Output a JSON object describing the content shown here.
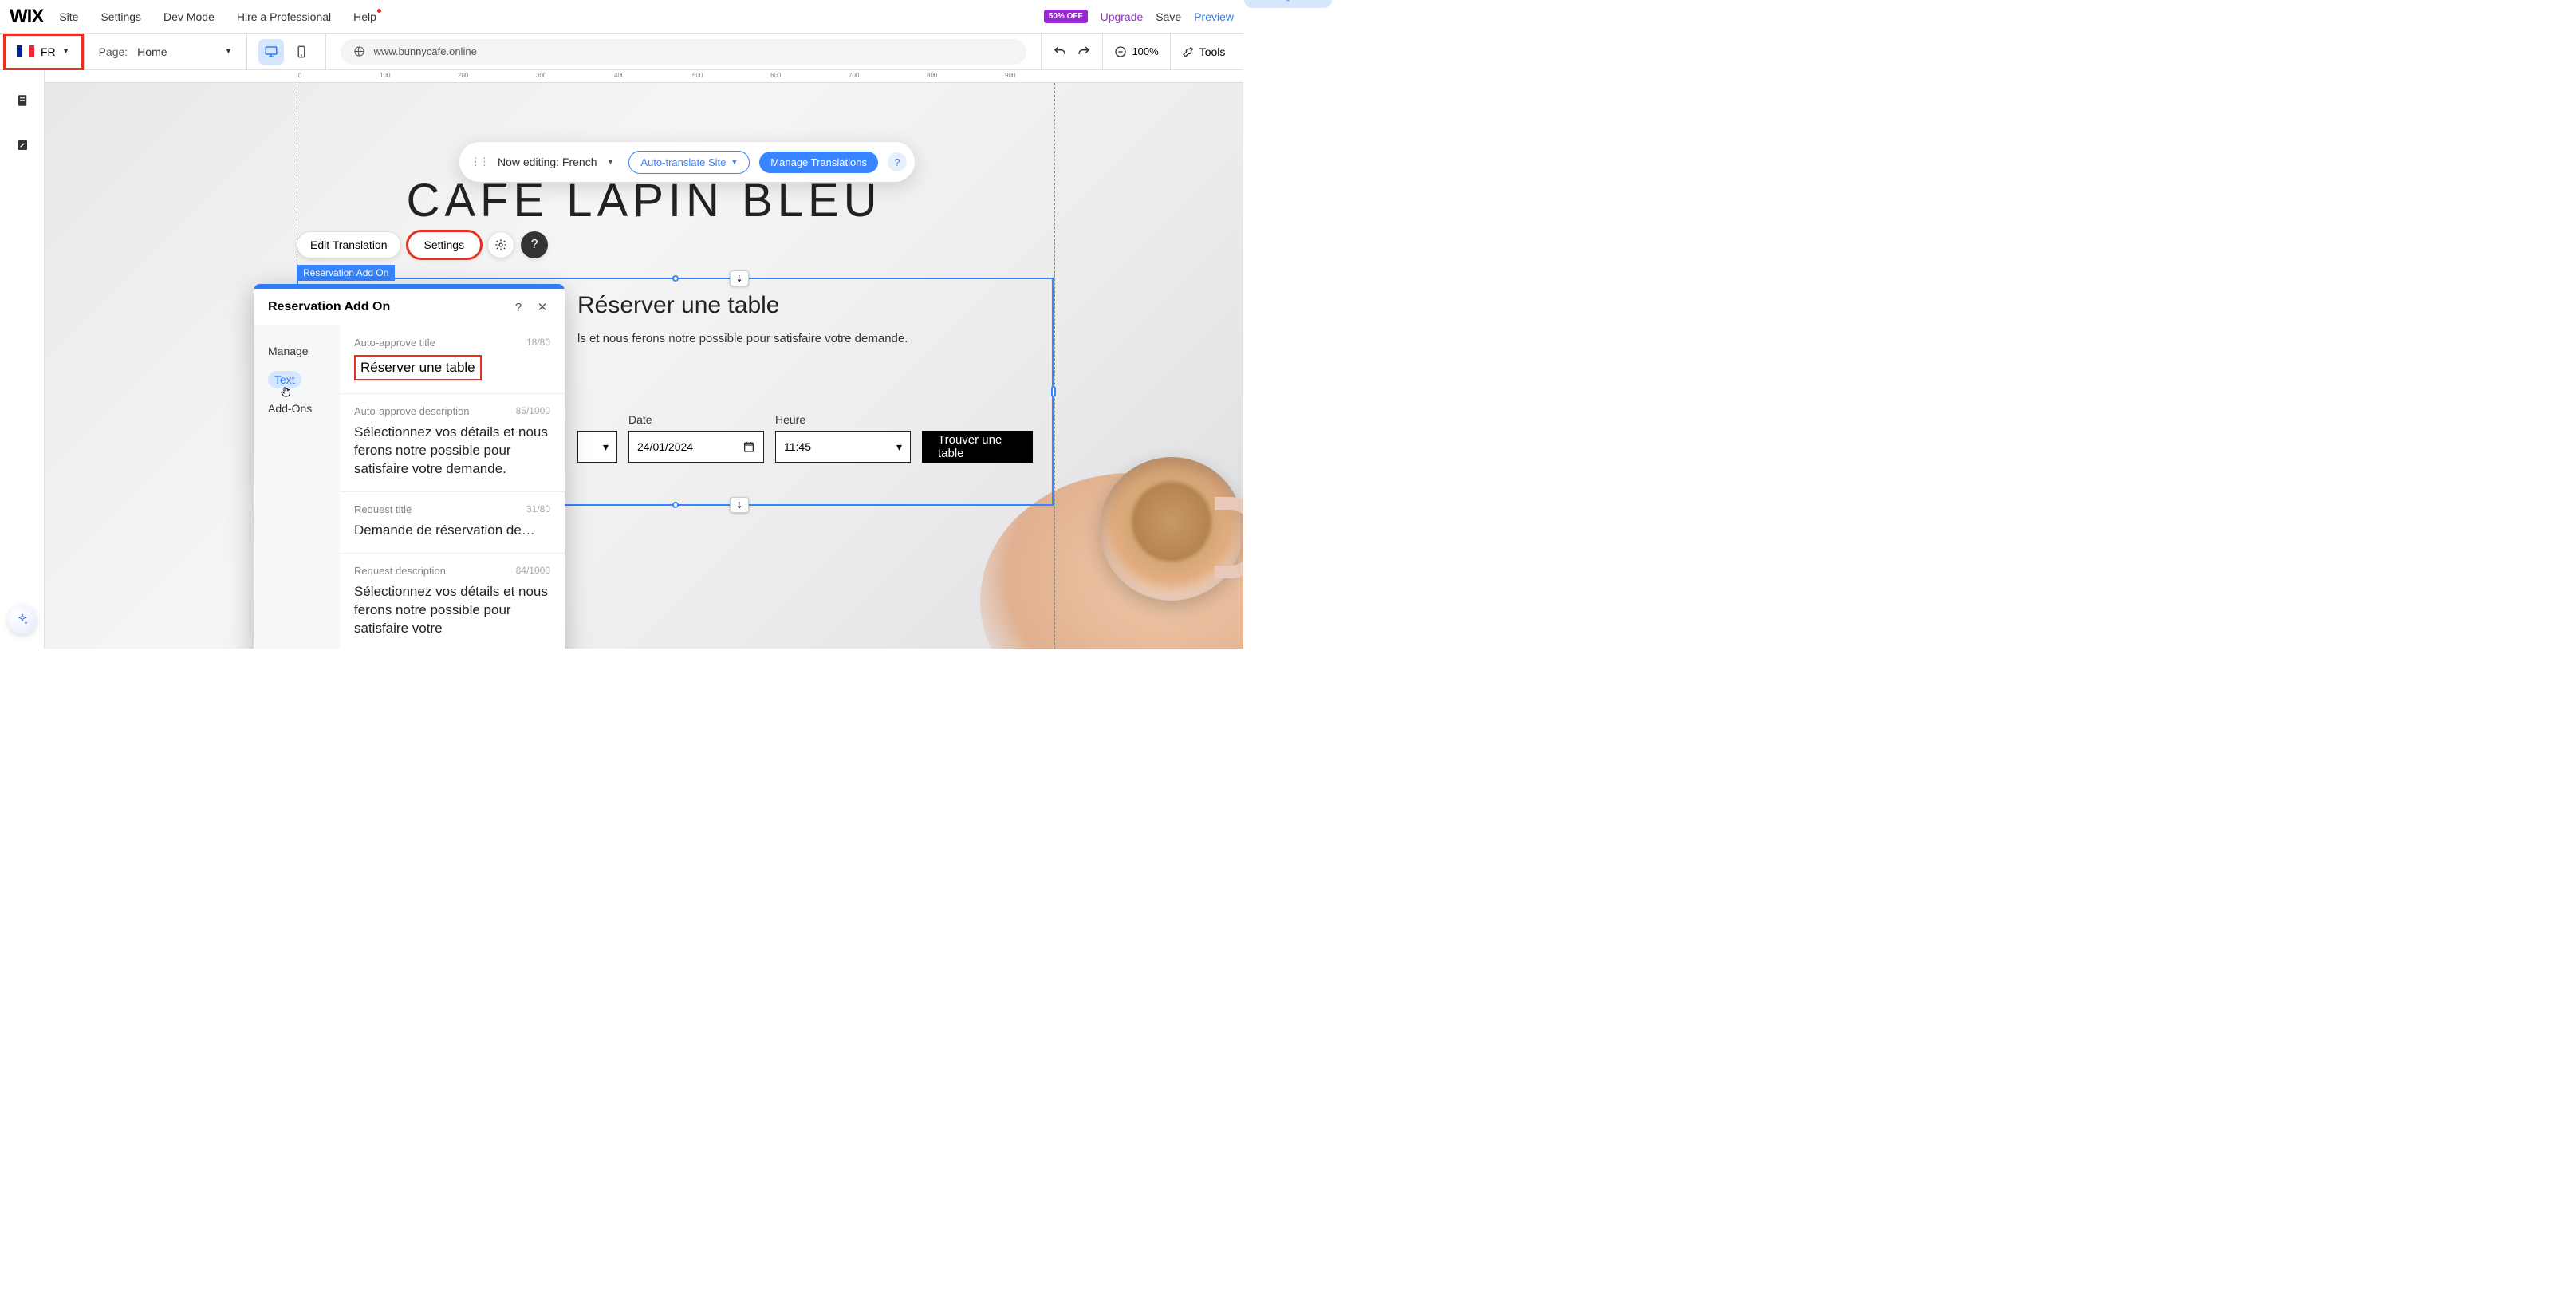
{
  "topbar": {
    "logo": "WIX",
    "menu": [
      "Site",
      "Settings",
      "Dev Mode",
      "Hire a Professional",
      "Help"
    ],
    "badge": "50% OFF",
    "upgrade": "Upgrade",
    "save": "Save",
    "preview": "Preview"
  },
  "secondbar": {
    "lang_code": "FR",
    "page_label": "Page:",
    "page_name": "Home",
    "url": "www.bunnycafe.online",
    "zoom": "100%",
    "tools": "Tools"
  },
  "editbar": {
    "now_editing": "Now editing: French",
    "auto_translate": "Auto-translate Site",
    "manage": "Manage Translations"
  },
  "site": {
    "title": "CAFÉ LAPIN BLEU"
  },
  "float_toolbar": {
    "edit": "Edit Translation",
    "settings": "Settings"
  },
  "selection_label": "Reservation Add On",
  "reservation_widget": {
    "title": "Réserver une table",
    "desc_suffix": "ls et nous ferons notre possible pour satisfaire votre demande.",
    "date_label": "Date",
    "date_value": "24/01/2024",
    "time_label": "Heure",
    "time_value": "11:45",
    "button": "Trouver une table"
  },
  "panel": {
    "title": "Reservation Add On",
    "nav": {
      "manage": "Manage",
      "text": "Text",
      "addons": "Add-Ons"
    },
    "sections": [
      {
        "label": "Auto-approve title",
        "count": "18/80",
        "value": "Réserver une table"
      },
      {
        "label": "Auto-approve description",
        "count": "85/1000",
        "value": "Sélectionnez vos détails et nous ferons notre possible pour satisfaire votre demande."
      },
      {
        "label": "Request title",
        "count": "31/80",
        "value": "Demande de réservation de…"
      },
      {
        "label": "Request description",
        "count": "84/1000",
        "value": "Sélectionnez vos détails et nous ferons notre possible pour satisfaire votre"
      }
    ]
  },
  "ruler_ticks": [
    "0",
    "100",
    "200",
    "300",
    "400",
    "500",
    "600",
    "700",
    "800",
    "900"
  ]
}
